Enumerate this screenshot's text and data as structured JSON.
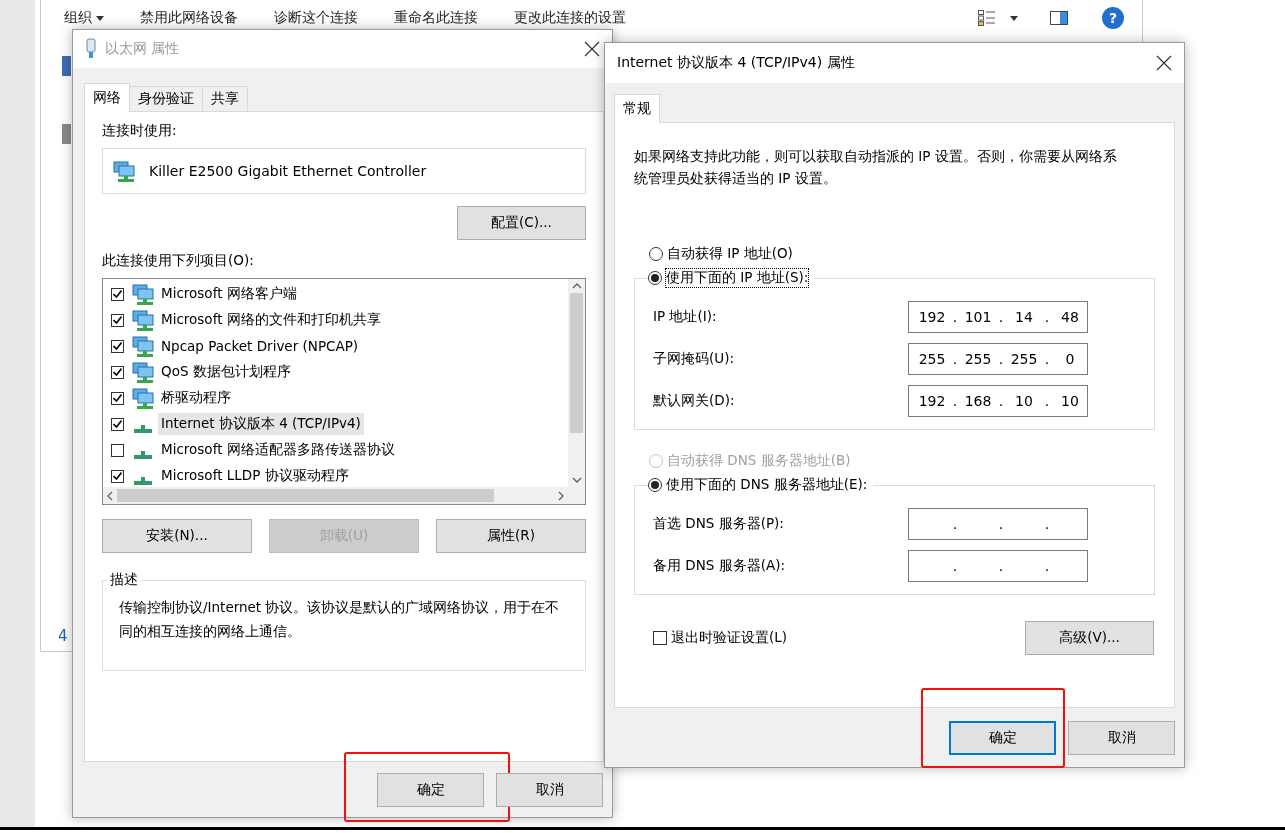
{
  "background_window": {
    "toolbar": [
      {
        "label": "组织",
        "kind": "menu"
      },
      {
        "label": "禁用此网络设备",
        "kind": "action"
      },
      {
        "label": "诊断这个连接",
        "kind": "action"
      },
      {
        "label": "重命名此连接",
        "kind": "action"
      },
      {
        "label": "更改此连接的设置",
        "kind": "action"
      }
    ],
    "help_button": "?",
    "footer_fragment": "4"
  },
  "ethernet_dialog": {
    "title": "以太网 属性",
    "active": false,
    "tabs": [
      {
        "label": "网络",
        "selected": true
      },
      {
        "label": "身份验证",
        "selected": false
      },
      {
        "label": "共享",
        "selected": false
      }
    ],
    "connect_using_label": "连接时使用:",
    "adapter": "Killer E2500 Gigabit Ethernet Controller",
    "configure_button": "配置(C)...",
    "items_label": "此连接使用下列项目(O):",
    "items": [
      {
        "label": "Microsoft 网络客户端",
        "kind": "service",
        "checked": true,
        "selected": false
      },
      {
        "label": "Microsoft 网络的文件和打印机共享",
        "kind": "service",
        "checked": true,
        "selected": false
      },
      {
        "label": "Npcap Packet Driver (NPCAP)",
        "kind": "service",
        "checked": true,
        "selected": false
      },
      {
        "label": "QoS 数据包计划程序",
        "kind": "service",
        "checked": true,
        "selected": false
      },
      {
        "label": "桥驱动程序",
        "kind": "service",
        "checked": true,
        "selected": false
      },
      {
        "label": "Internet 协议版本 4 (TCP/IPv4)",
        "kind": "protocol",
        "checked": true,
        "selected": true
      },
      {
        "label": "Microsoft 网络适配器多路传送器协议",
        "kind": "protocol",
        "checked": false,
        "selected": false
      },
      {
        "label": "Microsoft LLDP 协议驱动程序",
        "kind": "protocol",
        "checked": true,
        "selected": false
      }
    ],
    "buttons": [
      {
        "label": "安装(N)...",
        "disabled": false
      },
      {
        "label": "卸载(U)",
        "disabled": true
      },
      {
        "label": "属性(R)",
        "disabled": false
      }
    ],
    "description_title": "描述",
    "description": "传输控制协议/Internet 协议。该协议是默认的广域网络协议，用于在不同的相互连接的网络上通信。",
    "footer_buttons": [
      {
        "label": "确定",
        "default": false,
        "highlighted": true
      },
      {
        "label": "取消",
        "default": false,
        "highlighted": false
      }
    ]
  },
  "ipv4_dialog": {
    "title": "Internet 协议版本 4 (TCP/IPv4) 属性",
    "active": true,
    "tabs": [
      {
        "label": "常规",
        "selected": true
      }
    ],
    "intro": "如果网络支持此功能，则可以获取自动指派的 IP 设置。否则，你需要从网络系统管理员处获得适当的 IP 设置。",
    "ip_modes": [
      {
        "label": "自动获得 IP 地址(O)",
        "selected": false,
        "disabled": false,
        "focused": false
      },
      {
        "label": "使用下面的 IP 地址(S):",
        "selected": true,
        "disabled": false,
        "focused": true
      }
    ],
    "ip_fields": [
      {
        "label": "IP 地址(I):",
        "separator": ".",
        "octets": [
          "192",
          "101",
          "14",
          "48"
        ]
      },
      {
        "label": "子网掩码(U):",
        "separator": ".",
        "octets": [
          "255",
          "255",
          "255",
          "0"
        ]
      },
      {
        "label": "默认网关(D):",
        "separator": ".",
        "octets": [
          "192",
          "168",
          "10",
          "10"
        ]
      }
    ],
    "dns_modes": [
      {
        "label": "自动获得 DNS 服务器地址(B)",
        "selected": false,
        "disabled": true,
        "focused": false
      },
      {
        "label": "使用下面的 DNS 服务器地址(E):",
        "selected": true,
        "disabled": false,
        "focused": false
      }
    ],
    "dns_fields": [
      {
        "label": "首选 DNS 服务器(P):",
        "separator": "."
      },
      {
        "label": "备用 DNS 服务器(A):",
        "separator": "."
      }
    ],
    "validate_on_exit": {
      "label": "退出时验证设置(L)",
      "checked": false
    },
    "advanced_button": "高级(V)...",
    "footer_buttons": [
      {
        "label": "确定",
        "default": true,
        "highlighted": true
      },
      {
        "label": "取消",
        "default": false,
        "highlighted": false
      }
    ]
  }
}
